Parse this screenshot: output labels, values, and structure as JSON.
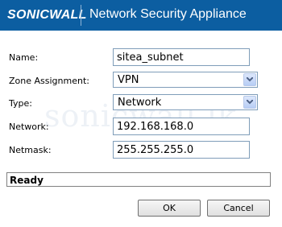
{
  "header": {
    "logo": "SONICWALL",
    "title": "Network Security Appliance"
  },
  "watermark": "sonicwall.lk",
  "form": {
    "name_label": "Name:",
    "name_value": "sitea_subnet",
    "zone_label": "Zone Assignment:",
    "zone_value": "VPN",
    "type_label": "Type:",
    "type_value": "Network",
    "network_label": "Network:",
    "network_value": "192.168.168.0",
    "netmask_label": "Netmask:",
    "netmask_value": "255.255.255.0"
  },
  "status": "Ready",
  "buttons": {
    "ok": "OK",
    "cancel": "Cancel"
  },
  "icons": {
    "dropdown": "chevron-down-icon"
  },
  "colors": {
    "header_bg": "#0c5ea1",
    "field_border": "#7f9db9"
  }
}
